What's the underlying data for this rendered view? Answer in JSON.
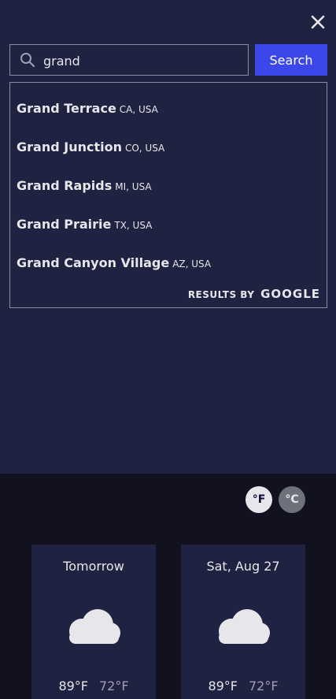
{
  "search": {
    "value": "grand",
    "button_label": "Search"
  },
  "results": [
    {
      "city": "Grand Terrace",
      "region": "CA, USA"
    },
    {
      "city": "Grand Junction",
      "region": "CO, USA"
    },
    {
      "city": "Grand Rapids",
      "region": "MI, USA"
    },
    {
      "city": "Grand Prairie",
      "region": "TX, USA"
    },
    {
      "city": "Grand Canyon Village",
      "region": "AZ, USA"
    }
  ],
  "attribution": {
    "prefix": "RESULTS BY",
    "brand": "GOOGLE"
  },
  "units": {
    "fahrenheit": "°F",
    "celsius": "°C",
    "selected": "fahrenheit"
  },
  "forecast": [
    {
      "day": "Tomorrow",
      "high": "89°F",
      "low": "72°F",
      "icon": "cloud-icon"
    },
    {
      "day": "Sat, Aug 27",
      "high": "89°F",
      "low": "72°F",
      "icon": "cloud-icon"
    }
  ],
  "icons": {
    "close": "close-icon",
    "search": "search-icon"
  },
  "colors": {
    "panel": "#1f2240",
    "background": "#12111f",
    "accent": "#3c47e9"
  }
}
